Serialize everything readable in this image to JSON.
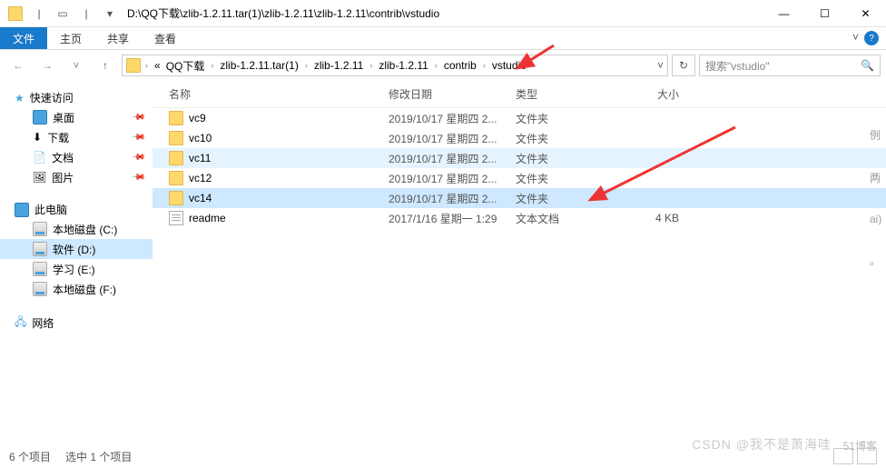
{
  "titlebar": {
    "path": "D:\\QQ下载\\zlib-1.2.11.tar(1)\\zlib-1.2.11\\zlib-1.2.11\\contrib\\vstudio"
  },
  "ribbon": {
    "file": "文件",
    "home": "主页",
    "share": "共享",
    "view": "查看"
  },
  "breadcrumb": {
    "ellipsis": "«",
    "items": [
      "QQ下载",
      "zlib-1.2.11.tar(1)",
      "zlib-1.2.11",
      "zlib-1.2.11",
      "contrib",
      "vstudio"
    ]
  },
  "search": {
    "placeholder": "搜索\"vstudio\""
  },
  "sidebar": {
    "quick": "快速访问",
    "desktop": "桌面",
    "downloads": "下载",
    "documents": "文档",
    "pictures": "图片",
    "thispc": "此电脑",
    "drive_c": "本地磁盘 (C:)",
    "drive_d": "软件 (D:)",
    "drive_e": "学习 (E:)",
    "drive_f": "本地磁盘 (F:)",
    "network": "网络"
  },
  "columns": {
    "name": "名称",
    "date": "修改日期",
    "type": "类型",
    "size": "大小"
  },
  "files": [
    {
      "name": "vc9",
      "date": "2019/10/17 星期四 2...",
      "type": "文件夹",
      "size": "",
      "icon": "folder",
      "state": ""
    },
    {
      "name": "vc10",
      "date": "2019/10/17 星期四 2...",
      "type": "文件夹",
      "size": "",
      "icon": "folder",
      "state": ""
    },
    {
      "name": "vc11",
      "date": "2019/10/17 星期四 2...",
      "type": "文件夹",
      "size": "",
      "icon": "folder",
      "state": "hov"
    },
    {
      "name": "vc12",
      "date": "2019/10/17 星期四 2...",
      "type": "文件夹",
      "size": "",
      "icon": "folder",
      "state": ""
    },
    {
      "name": "vc14",
      "date": "2019/10/17 星期四 2...",
      "type": "文件夹",
      "size": "",
      "icon": "folder",
      "state": "hl"
    },
    {
      "name": "readme",
      "date": "2017/1/16 星期一 1:29",
      "type": "文本文档",
      "size": "4 KB",
      "icon": "txt",
      "state": ""
    }
  ],
  "status": {
    "count": "6 个项目",
    "selected": "选中 1 个项目"
  },
  "watermark": {
    "w1": "CSDN @我不是萧海哇",
    "w2": "51博客"
  }
}
